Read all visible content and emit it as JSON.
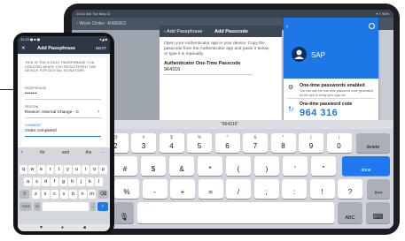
{
  "tablet": {
    "status_left": "10:34 AM  Tue May 11",
    "status_right": "▾ ≡ 96%",
    "topbar_title": "‹  Work Order: 4068962",
    "modal": {
      "back_label": "‹ Add Passphrase",
      "title": "Add Passcode",
      "instructions": "Open your Authenticator app in your device. Copy the passcode from the Authenticator app and paste it below, or type it in manually.",
      "field_label": "Authenticator One-Time Passcode",
      "field_value": "964316"
    },
    "sap_app": {
      "back": "‹",
      "name": "SAP",
      "row1_title": "One-time passwords enabled",
      "row1_sub": "You can use the one-time password code generated by the app to verify your sign-ins",
      "row2_title": "One-time password code",
      "row2_code": "964 316"
    },
    "keyboard": {
      "suggestion": "\"964316\"",
      "row1": [
        {
          "sub": "!",
          "main": "1"
        },
        {
          "sub": "@",
          "main": "2"
        },
        {
          "sub": "#",
          "main": "3"
        },
        {
          "sub": "$",
          "main": "4"
        },
        {
          "sub": "%",
          "main": "5"
        },
        {
          "sub": "^",
          "main": "6"
        },
        {
          "sub": "&",
          "main": "7"
        },
        {
          "sub": "*",
          "main": "8"
        },
        {
          "sub": "(",
          "main": "9"
        },
        {
          "sub": ")",
          "main": "0"
        }
      ],
      "delete_label": "delete",
      "row2": [
        {
          "sub": "",
          "main": "@"
        },
        {
          "sub": "",
          "main": "#"
        },
        {
          "sub": "",
          "main": "$"
        },
        {
          "sub": "",
          "main": "&"
        },
        {
          "sub": "",
          "main": "*"
        },
        {
          "sub": "",
          "main": "("
        },
        {
          "sub": "",
          "main": ")"
        },
        {
          "sub": "",
          "main": "'"
        },
        {
          "sub": "",
          "main": "\""
        }
      ],
      "done_label": "done",
      "row3": [
        {
          "sub": "",
          "main": "%"
        },
        {
          "sub": "",
          "main": "-"
        },
        {
          "sub": "",
          "main": "+"
        },
        {
          "sub": "",
          "main": "="
        },
        {
          "sub": "",
          "main": "/"
        },
        {
          "sub": "",
          "main": ";"
        },
        {
          "sub": "",
          "main": ":"
        },
        {
          "sub": "",
          "main": "!"
        },
        {
          "sub": "",
          "main": "?"
        }
      ],
      "shift_label": "#+=",
      "abc_label": "ABC"
    }
  },
  "phone": {
    "status_left": "11:13 ◼ ■ ◼",
    "status_right": "▾◢ ■",
    "close": "✕",
    "title": "Add Passphrase",
    "next": "NEXT",
    "info": "THIS IS THE 8 DIGIT PASSPHRASE YOU CREATED WHEN YOU REGISTERED THE DEVICE FOR DIGITAL SIGNATURE.",
    "passphrase_label": "PASSPHRASE",
    "passphrase_value": "••••••••",
    "reason_label": "REASON",
    "reason_value": "Reason: Internal Change - C",
    "comment_label": "COMMENT",
    "comment_value": "Order completed",
    "keyboard": {
      "suggestions": [
        "for",
        "and",
        "the"
      ],
      "row1": [
        "q",
        "w",
        "e",
        "r",
        "t",
        "y",
        "u",
        "i",
        "o",
        "p"
      ],
      "row2": [
        "a",
        "s",
        "d",
        "f",
        "g",
        "h",
        "j",
        "k",
        "l"
      ],
      "row3": [
        "z",
        "x",
        "c",
        "v",
        "b",
        "n",
        "m"
      ],
      "sym_label": "?123",
      "period": "."
    },
    "nav": [
      "▼",
      "●",
      "■"
    ]
  }
}
